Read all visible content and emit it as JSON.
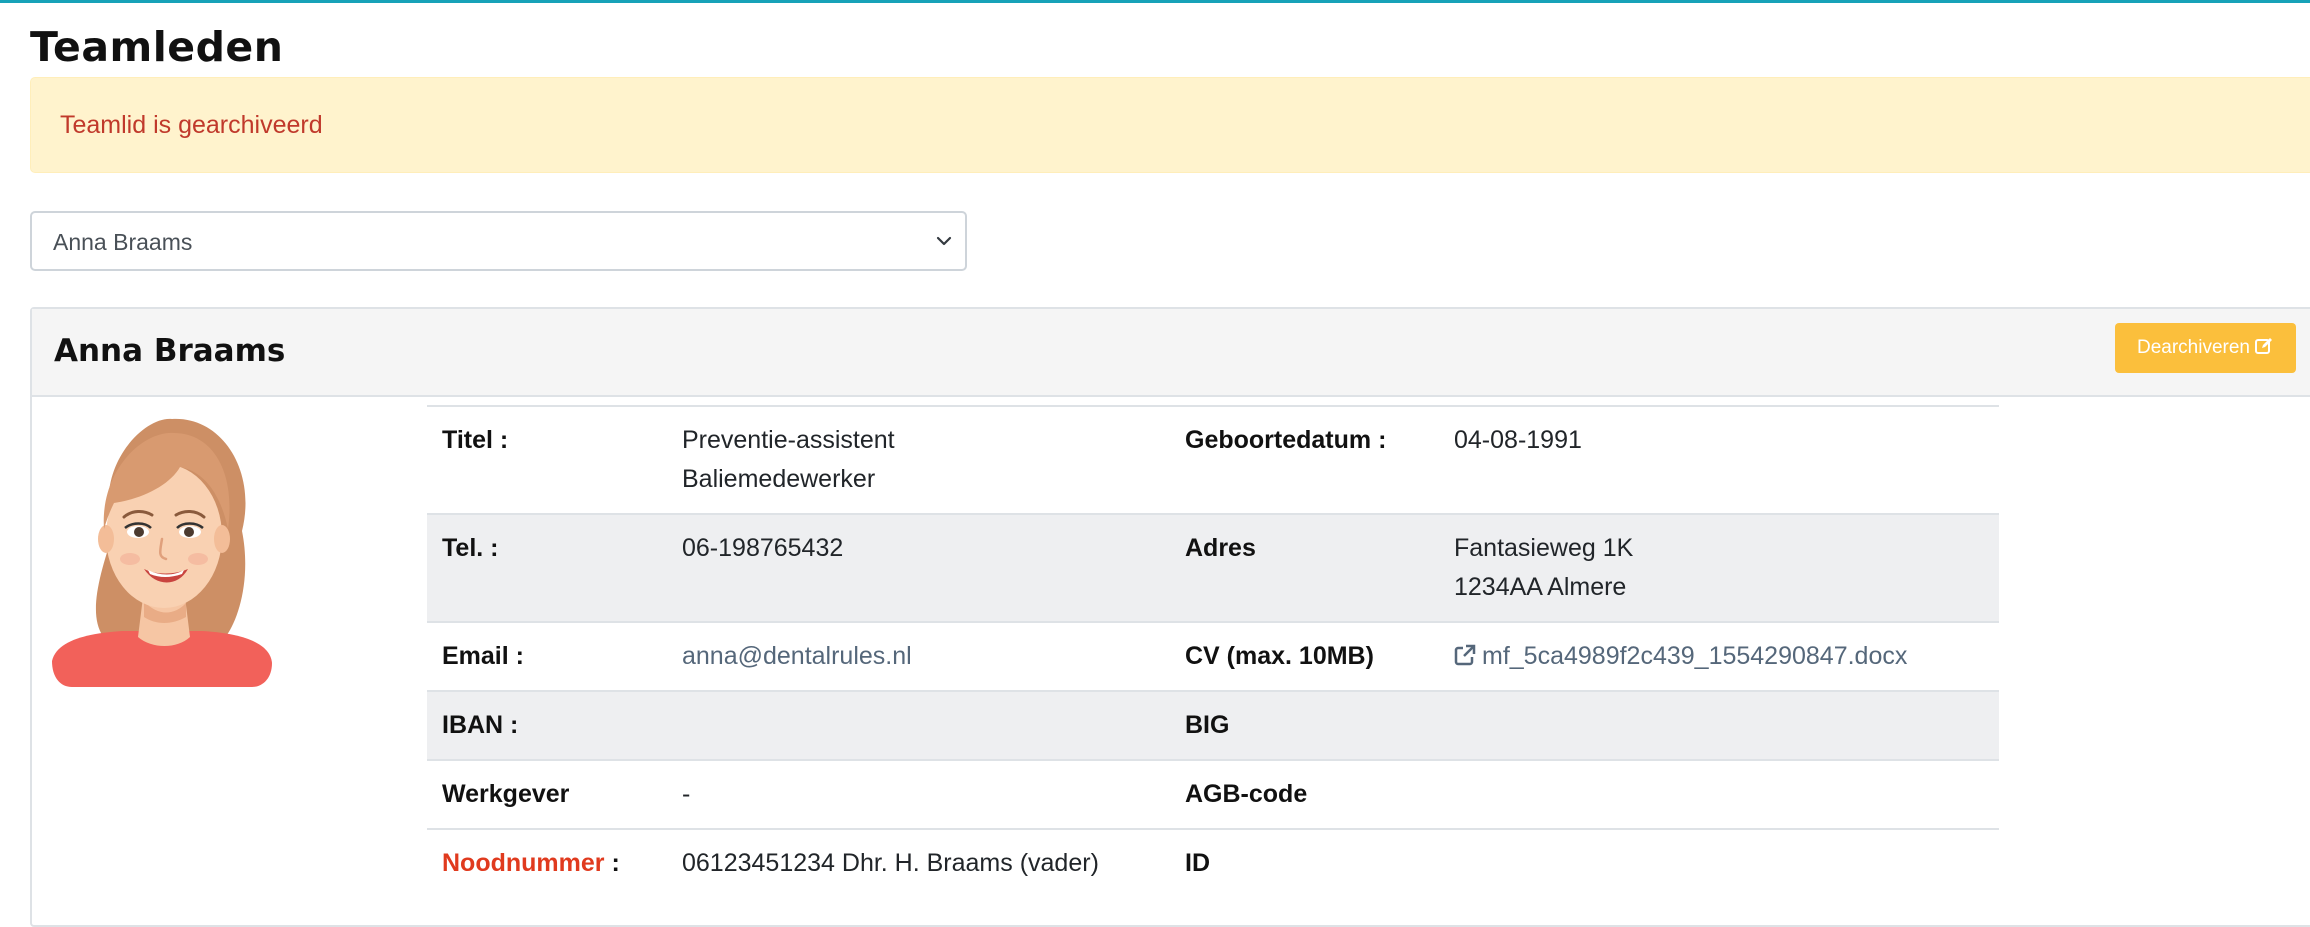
{
  "page": {
    "title": "Teamleden"
  },
  "alert": {
    "message": "Teamlid is gearchiveerd",
    "color": "#c0392b",
    "background": "#fff3cd"
  },
  "member_select": {
    "selected": "Anna Braams",
    "icon": "chevron-down-icon"
  },
  "card": {
    "name": "Anna Braams",
    "dearchive_label": "Dearchiveren",
    "dearchive_icon": "edit-icon",
    "accent": "#fbbf3c"
  },
  "details": {
    "titel_label": "Titel :",
    "titel_line1": "Preventie-assistent",
    "titel_line2": "Baliemedewerker",
    "geboortedatum_label": "Geboortedatum :",
    "geboortedatum_value": "04-08-1991",
    "tel_label": "Tel. :",
    "tel_value": "06-198765432",
    "adres_label": "Adres",
    "adres_line1": "Fantasieweg 1K",
    "adres_line2": "1234AA Almere",
    "email_label": "Email :",
    "email_value": "anna@dentalrules.nl",
    "cv_label": "CV (max. 10MB)",
    "cv_file": "mf_5ca4989f2c439_1554290847.docx",
    "cv_icon": "external-link-icon",
    "iban_label": "IBAN :",
    "iban_value": "",
    "big_label": "BIG",
    "big_value": "",
    "werkgever_label": "Werkgever",
    "werkgever_value": "-",
    "agb_label": "AGB-code",
    "agb_value": "",
    "noodnummer_label": "Noodnummer",
    "noodnummer_suffix": " :",
    "noodnummer_value": "06123451234 Dhr. H. Braams (vader)",
    "id_label": "ID",
    "id_value": "",
    "emergency_color": "#e03a1e"
  }
}
